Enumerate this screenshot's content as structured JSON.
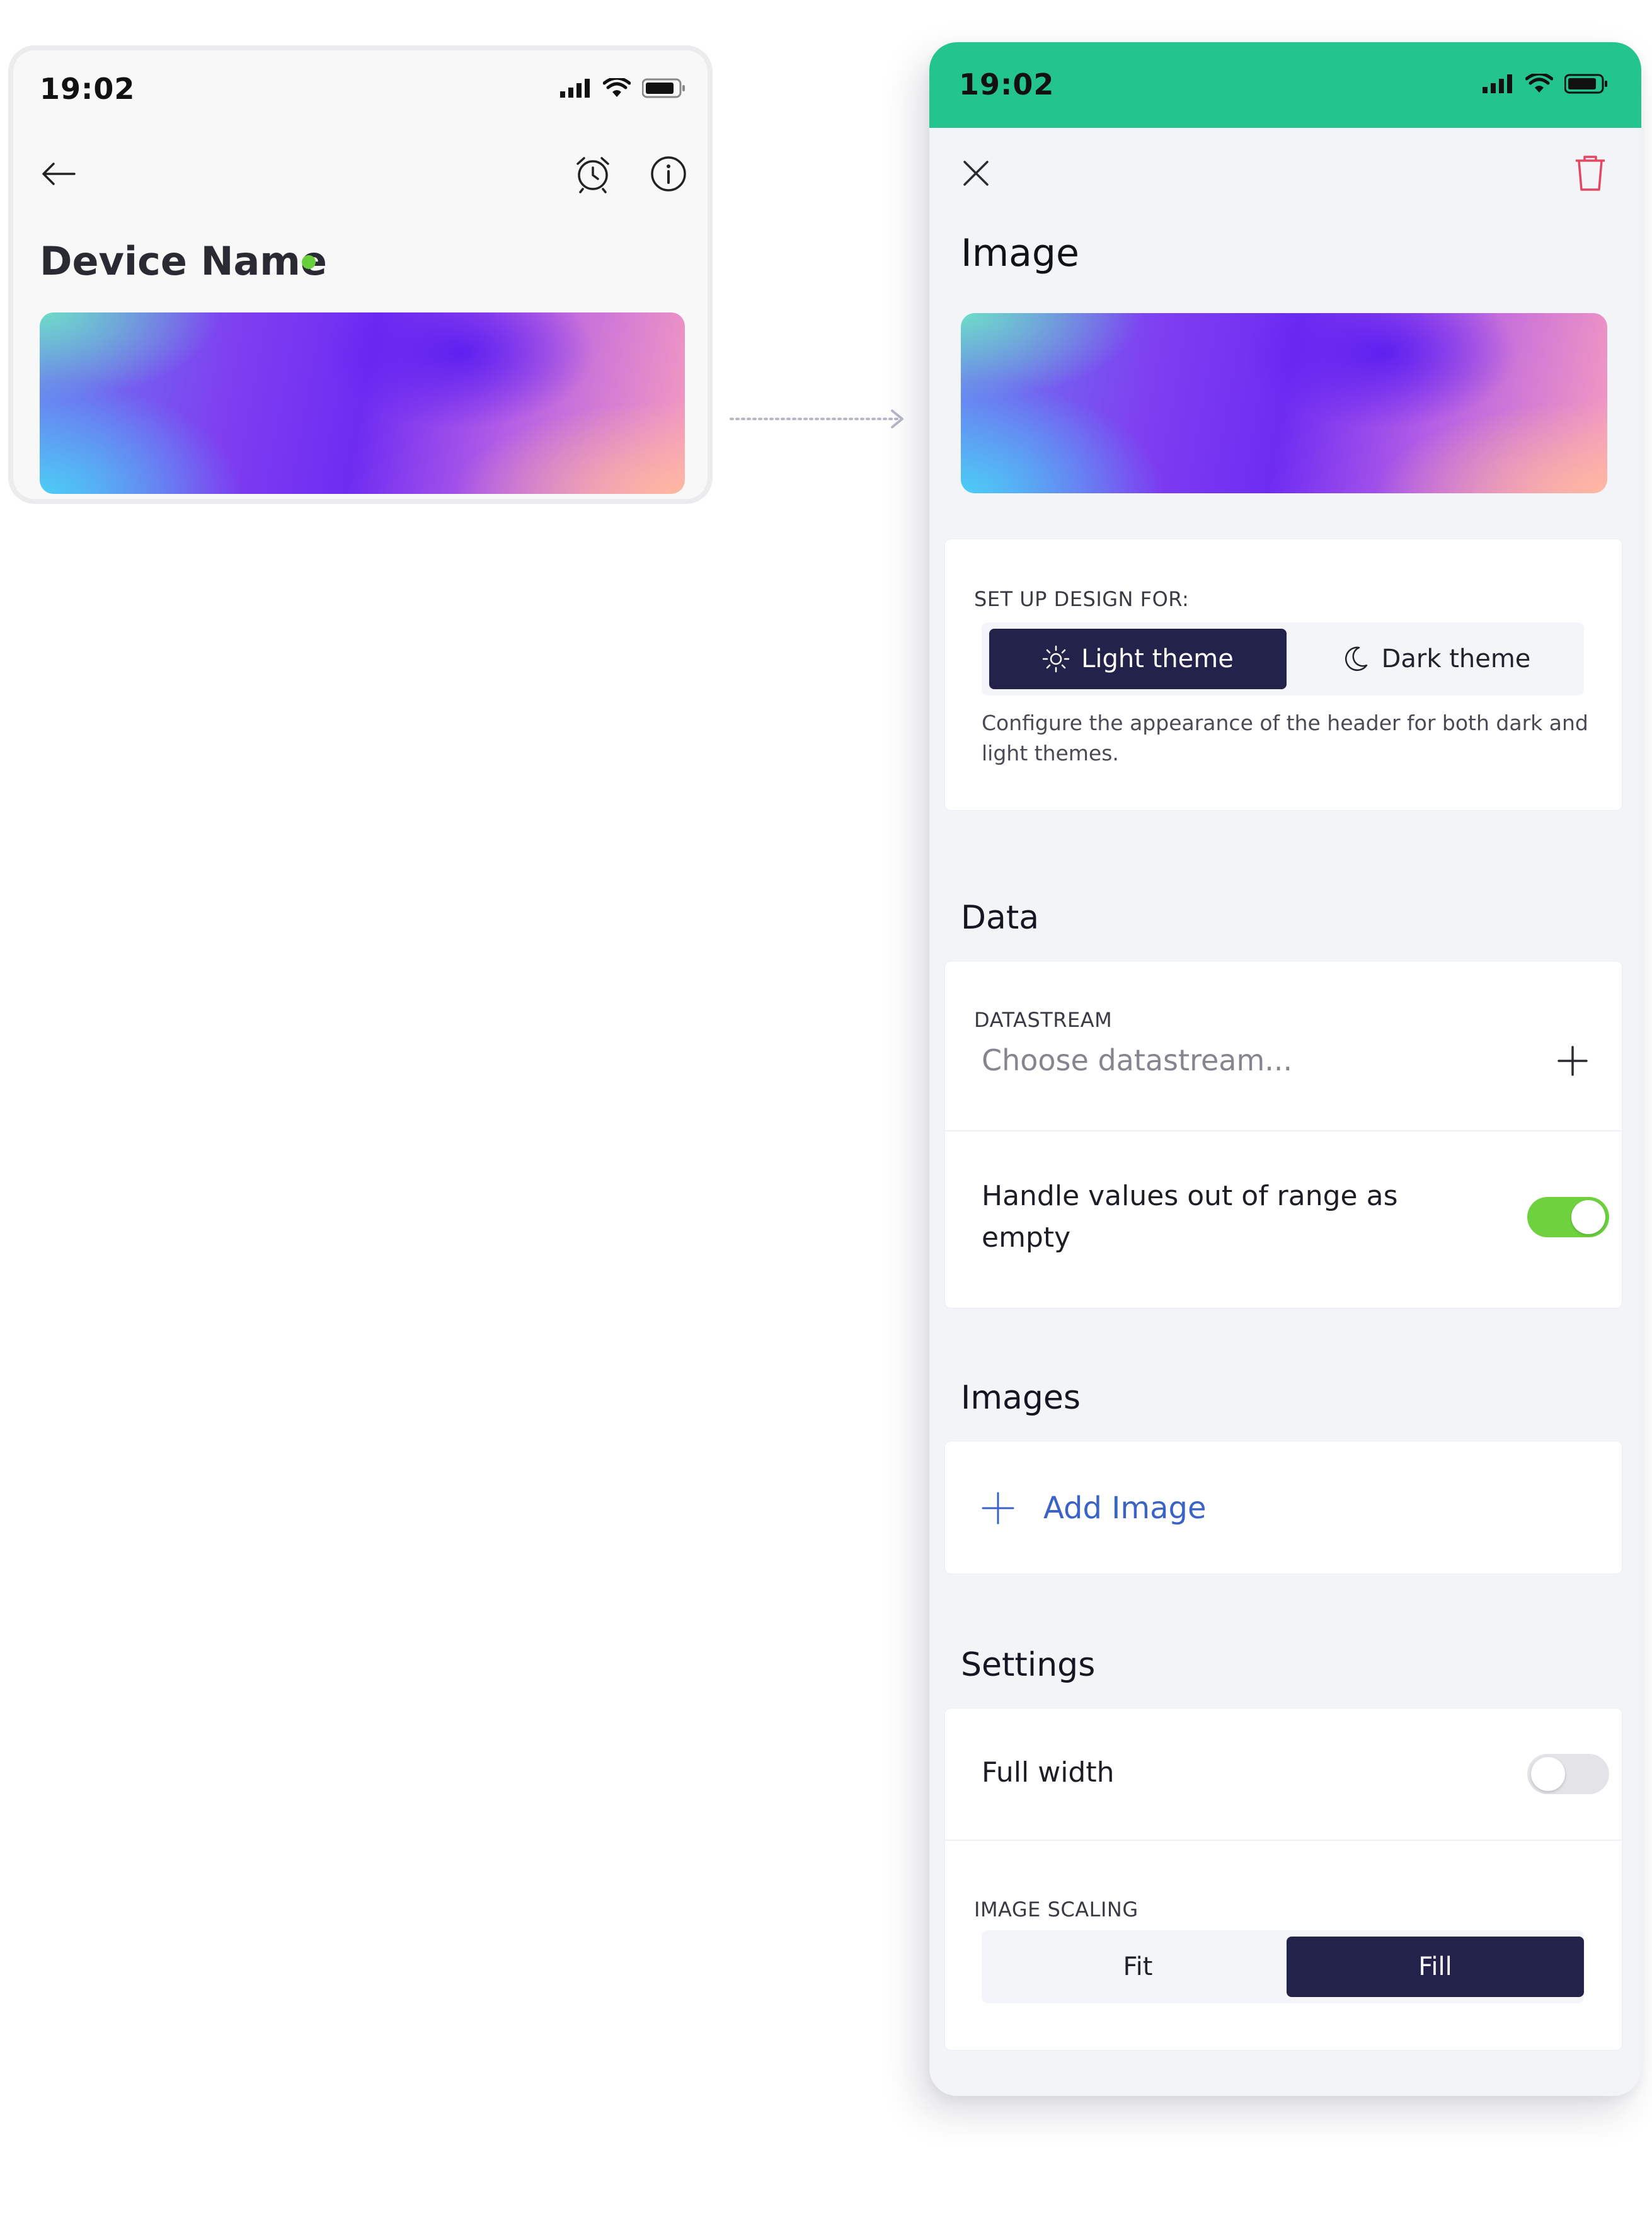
{
  "left_phone": {
    "status_time": "19:02",
    "device_name": "Device Name",
    "online_status_color": "#66cf3a",
    "icons": [
      "back-arrow-icon",
      "alarm-clock-icon",
      "info-icon"
    ]
  },
  "right_phone": {
    "status_time": "19:02",
    "status_bar_color": "#23c48e",
    "title": "Image",
    "design_section": {
      "label": "SET UP DESIGN FOR:",
      "options": [
        "Light theme",
        "Dark theme"
      ],
      "selected": "Light theme",
      "hint": "Configure the appearance of the header for both dark and light themes."
    },
    "data_section": {
      "title": "Data",
      "datastream_label": "DATASTREAM",
      "datastream_placeholder": "Choose datastream...",
      "handle_out_of_range_label": "Handle values out of range as empty",
      "handle_out_of_range_enabled": true,
      "toggle_on_color": "#6ed23f"
    },
    "images_section": {
      "title": "Images",
      "add_image_label": "Add Image",
      "link_color": "#3a63c8"
    },
    "settings_section": {
      "title": "Settings",
      "full_width_label": "Full width",
      "full_width_enabled": false,
      "scaling_label": "IMAGE SCALING",
      "scaling_options": [
        "Fit",
        "Fill"
      ],
      "scaling_selected": "Fill"
    },
    "accent_dark": "#22224a",
    "delete_icon_color": "#e6455f"
  }
}
